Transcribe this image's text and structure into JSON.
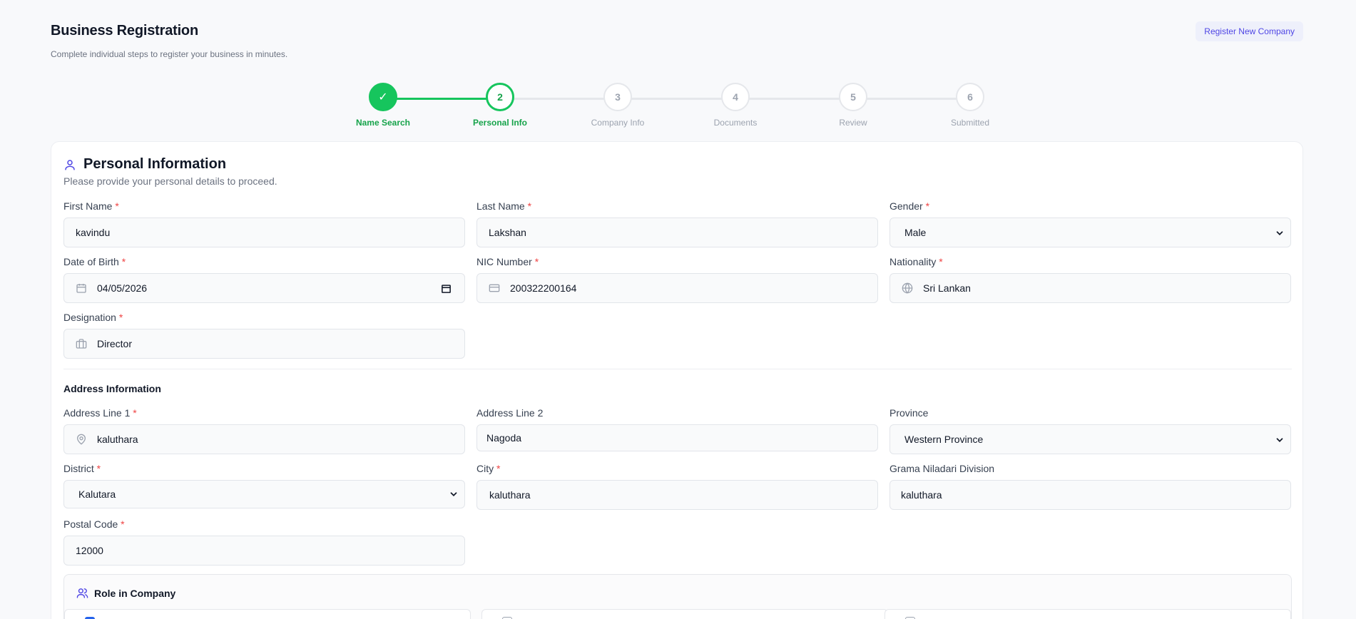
{
  "header": {
    "title": "Business Registration",
    "subtitle": "Complete individual steps to register your business in minutes.",
    "register_button": "Register New Company"
  },
  "stepper": {
    "steps": [
      {
        "number": "✓",
        "label": "Name Search",
        "state": "done"
      },
      {
        "number": "2",
        "label": "Personal Info",
        "state": "active"
      },
      {
        "number": "3",
        "label": "Company Info",
        "state": "pending"
      },
      {
        "number": "4",
        "label": "Documents",
        "state": "pending"
      },
      {
        "number": "5",
        "label": "Review",
        "state": "pending"
      },
      {
        "number": "6",
        "label": "Submitted",
        "state": "pending"
      }
    ]
  },
  "personal": {
    "title": "Personal Information",
    "subtitle": "Please provide your personal details to proceed.",
    "first_name": {
      "label": "First Name",
      "value": "kavindu"
    },
    "last_name": {
      "label": "Last Name",
      "value": "Lakshan"
    },
    "gender": {
      "label": "Gender",
      "value": "Male"
    },
    "dob": {
      "label": "Date of Birth",
      "value": "04/05/2026"
    },
    "nic": {
      "label": "NIC Number",
      "value": "200322200164"
    },
    "nationality": {
      "label": "Nationality",
      "value": "Sri Lankan"
    },
    "designation": {
      "label": "Designation",
      "value": "Director"
    }
  },
  "address": {
    "title": "Address Information",
    "line1": {
      "label": "Address Line 1",
      "value": "kaluthara"
    },
    "line2": {
      "label": "Address Line 2",
      "value": "Nagoda"
    },
    "province": {
      "label": "Province",
      "value": "Western Province"
    },
    "district": {
      "label": "District",
      "value": "Kalutara"
    },
    "city": {
      "label": "City",
      "value": "kaluthara"
    },
    "gn_division": {
      "label": "Grama Niladari Division",
      "value": "kaluthara"
    },
    "postal_code": {
      "label": "Postal Code",
      "value": "12000"
    }
  },
  "role": {
    "title": "Role in Company",
    "options_checked": [
      true,
      false,
      false
    ]
  },
  "required_mark": "*",
  "colors": {
    "accent": "#4f46e5",
    "success": "#16c55d",
    "required": "#ef4444"
  }
}
